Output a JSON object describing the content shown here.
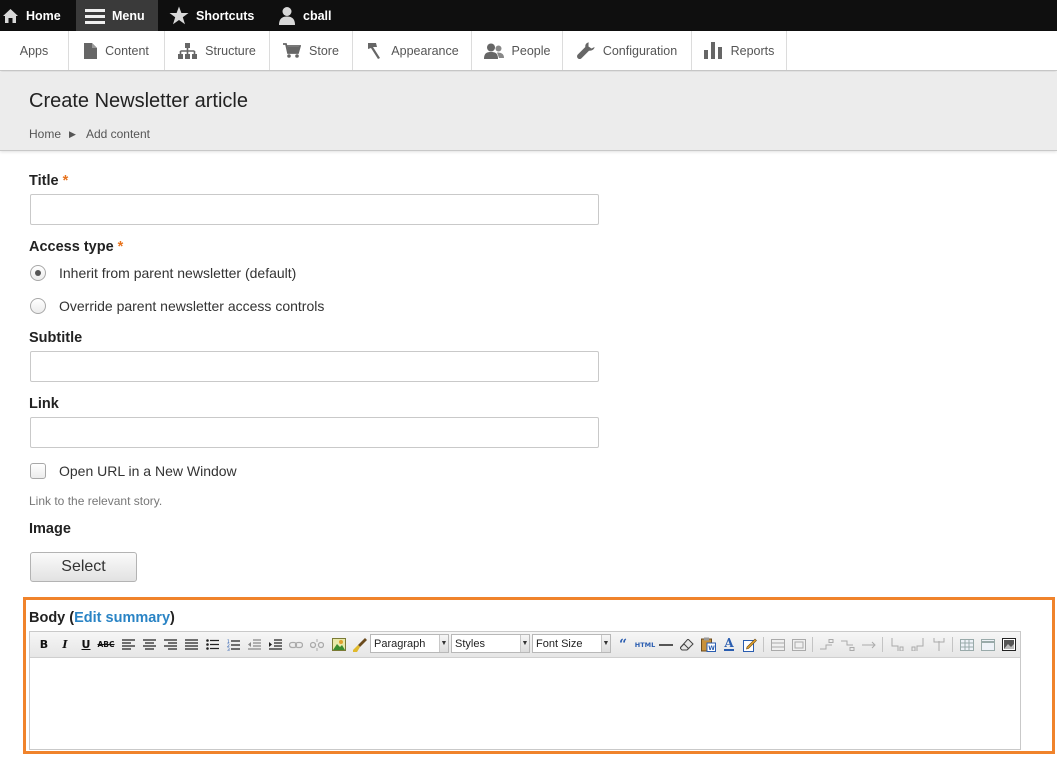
{
  "toolbar": {
    "home": "Home",
    "menu": "Menu",
    "shortcuts": "Shortcuts",
    "user": "cball"
  },
  "tray": {
    "items": [
      "Apps",
      "Content",
      "Structure",
      "Store",
      "Appearance",
      "People",
      "Configuration",
      "Reports"
    ]
  },
  "page": {
    "title": "Create Newsletter article",
    "breadcrumb": [
      "Home",
      "Add content"
    ]
  },
  "form": {
    "title_label": "Title",
    "required_mark": "*",
    "access_label": "Access type",
    "access_options": [
      {
        "label": "Inherit from parent newsletter (default)",
        "checked": true
      },
      {
        "label": "Override parent newsletter access controls",
        "checked": false
      }
    ],
    "subtitle_label": "Subtitle",
    "link_label": "Link",
    "open_new_window_label": "Open URL in a New Window",
    "link_help": "Link to the relevant story.",
    "image_label": "Image",
    "select_button": "Select",
    "body_label": "Body",
    "edit_summary": "Edit summary"
  },
  "editor": {
    "format_select": "Paragraph",
    "styles_select": "Styles",
    "font_size_select": "Font Size",
    "icons": [
      "bold-icon",
      "italic-icon",
      "underline-icon",
      "strikethrough-icon",
      "align-left-icon",
      "align-center-icon",
      "align-right-icon",
      "justify-icon",
      "bullet-list-icon",
      "numbered-list-icon",
      "outdent-icon",
      "indent-icon",
      "link-icon",
      "unlink-icon",
      "image-icon",
      "cleanup-icon",
      "blockquote-icon",
      "html-icon",
      "horizontal-rule-icon",
      "remove-format-icon",
      "paste-word-icon",
      "font-color-icon",
      "edit-icon"
    ]
  },
  "colors": {
    "highlight": "#f0832b",
    "required": "#e7731d",
    "link": "#2a84c5",
    "toolbar_bg": "#0f0f0f"
  }
}
